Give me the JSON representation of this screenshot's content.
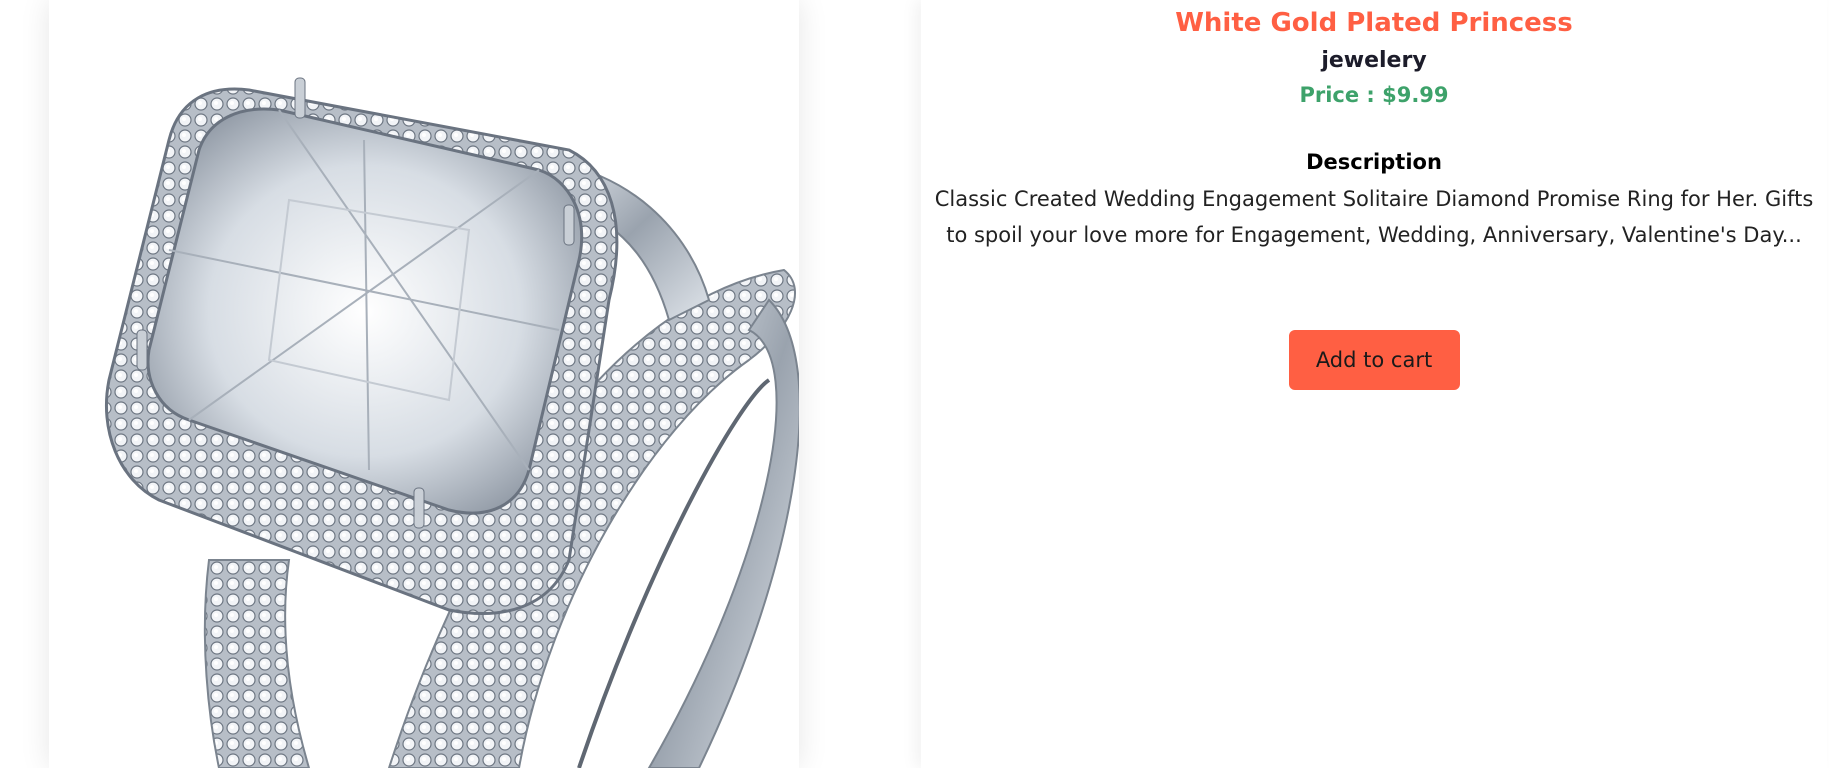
{
  "product": {
    "title": "White Gold Plated Princess",
    "category": "jewelery",
    "price_label": "Price : $9.99",
    "description_heading": "Description",
    "description": "Classic Created Wedding Engagement Solitaire Diamond Promise Ring for Her. Gifts to spoil your love more for Engagement, Wedding, Anniversary, Valentine's Day...",
    "image_icon": "diamond-ring-image"
  },
  "actions": {
    "add_to_cart_label": "Add to cart"
  },
  "colors": {
    "accent": "#ff5f43",
    "price": "#3da26a",
    "text_dark": "#1c1c2a"
  }
}
